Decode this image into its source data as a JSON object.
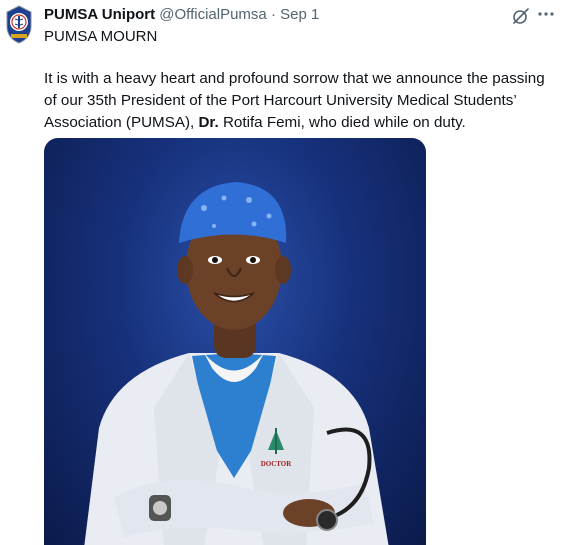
{
  "author": {
    "name": "PUMSA Uniport",
    "handle": "@OfficialPumsa",
    "separator": "·",
    "time": "Sep 1"
  },
  "subtitle": "PUMSA MOURN",
  "body": {
    "before_bold": "It is with a heavy heart and profound sorrow that we announce the passing of our 35th President of the Port Harcourt University Medical Students’ Association (PUMSA), ",
    "bold": "Dr.",
    "after_bold": " Rotifa Femi, who died while on duty."
  },
  "photo": {
    "coat_badge_text": "DOCTOR"
  },
  "icons": {
    "avatar": "association-logo-icon",
    "grok": "grok-icon",
    "more": "more-icon"
  },
  "colors": {
    "text": "#0f1419",
    "secondary": "#536471",
    "photo_background": "#16307a",
    "cap": "#2f6fd6",
    "scrubs": "#2d7fd0",
    "coat": "#e9ecf2"
  }
}
